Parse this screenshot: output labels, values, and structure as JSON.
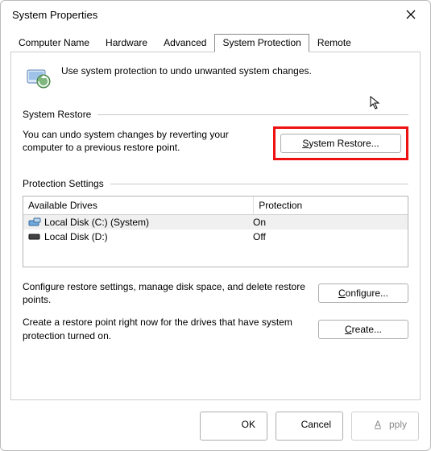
{
  "window": {
    "title": "System Properties"
  },
  "tabs": {
    "items": [
      {
        "label": "Computer Name"
      },
      {
        "label": "Hardware"
      },
      {
        "label": "Advanced"
      },
      {
        "label": "System Protection"
      },
      {
        "label": "Remote"
      }
    ],
    "active_index": 3
  },
  "intro": {
    "text": "Use system protection to undo unwanted system changes."
  },
  "restore_group": {
    "label": "System Restore",
    "text": "You can undo system changes by reverting your computer to a previous restore point.",
    "button_prefix": "S",
    "button_suffix": "ystem Restore..."
  },
  "protection_group": {
    "label": "Protection Settings",
    "columns": {
      "drives": "Available Drives",
      "protection": "Protection"
    },
    "drives": [
      {
        "icon": "drive-system-icon",
        "name": "Local Disk (C:) (System)",
        "protection": "On",
        "selected": true
      },
      {
        "icon": "drive-icon",
        "name": "Local Disk (D:)",
        "protection": "Off",
        "selected": false
      }
    ],
    "configure": {
      "text": "Configure restore settings, manage disk space, and delete restore points.",
      "button_prefix": "C",
      "button_suffix": "onfigure..."
    },
    "create": {
      "text": "Create a restore point right now for the drives that have system protection turned on.",
      "button_prefix": "C",
      "button_suffix": "reate..."
    }
  },
  "footer": {
    "ok": "OK",
    "cancel": "Cancel",
    "apply_prefix": "A",
    "apply_suffix": "pply"
  }
}
